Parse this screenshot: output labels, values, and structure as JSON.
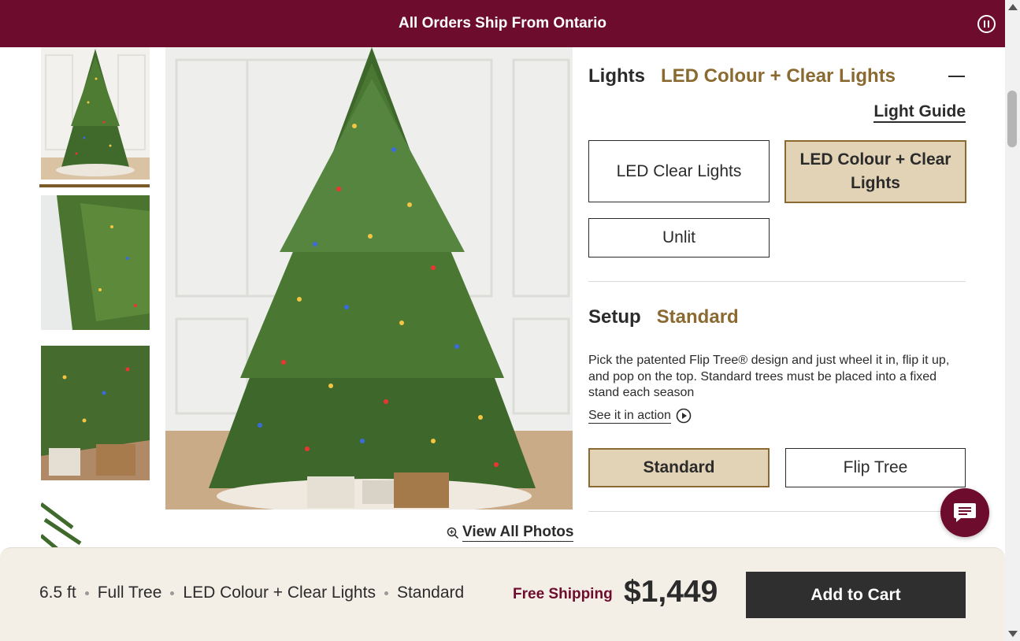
{
  "announcement": {
    "text": "All Orders Ship From Ontario",
    "pause_icon": "pause-circle-icon"
  },
  "gallery": {
    "thumbnails": [
      {
        "name": "full-tree-white-wall"
      },
      {
        "name": "tree-branches-closeup"
      },
      {
        "name": "lights-and-gifts-closeup"
      },
      {
        "name": "branch-tip-detail"
      }
    ],
    "main_image": "lit-christmas-tree-with-gifts",
    "view_all_label": "View All Photos",
    "zoom_icon": "zoom-in-icon"
  },
  "lights": {
    "label": "Lights",
    "selected_value": "LED Colour + Clear Lights",
    "guide_link": "Light Guide",
    "options": [
      "LED Clear Lights",
      "LED Colour + Clear Lights",
      "Unlit"
    ]
  },
  "setup": {
    "label": "Setup",
    "selected_value": "Standard",
    "description": "Pick the patented Flip Tree® design and just wheel it in, flip it up, and pop on the top. Standard trees must be placed into a fixed stand each season",
    "action_link": "See it in action",
    "action_icon": "play-circle-icon",
    "options": [
      "Standard",
      "Flip Tree"
    ]
  },
  "chat": {
    "icon": "chat-bubble-icon"
  },
  "sticky_bar": {
    "summary": [
      "6.5 ft",
      "Full Tree",
      "LED Colour + Clear Lights",
      "Standard"
    ],
    "shipping": "Free Shipping",
    "price": "$1,449",
    "cta": "Add to Cart"
  },
  "colors": {
    "brand": "#6e0c2e",
    "accent": "#8a6a30",
    "selected_bg": "#e3d3b6",
    "sticky_bg": "#f3efe7"
  }
}
